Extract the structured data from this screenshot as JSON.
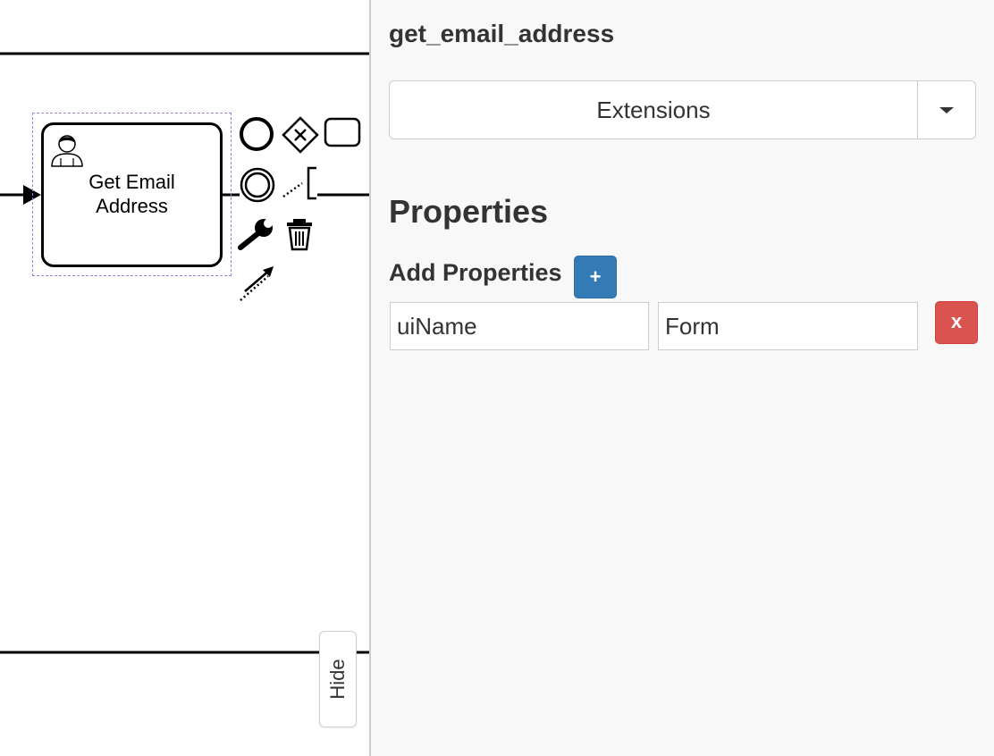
{
  "canvas": {
    "task": {
      "label": "Get Email\nAddress",
      "type_icon": "user-task-icon"
    },
    "context_pad": [
      {
        "name": "start-event-icon"
      },
      {
        "name": "exclusive-gateway-icon"
      },
      {
        "name": "task-icon"
      },
      {
        "name": "intermediate-event-icon"
      },
      {
        "name": "text-annotation-icon"
      },
      {
        "name": "wrench-icon"
      },
      {
        "name": "trash-icon"
      },
      {
        "name": "connect-icon"
      }
    ],
    "hide_label": "Hide"
  },
  "panel": {
    "title": "get_email_address",
    "tab": {
      "selected": "Extensions"
    },
    "section_title": "Properties",
    "add_label": "Add Properties",
    "add_button": "+",
    "properties": [
      {
        "key": "uiName",
        "value": "Form",
        "remove_label": "x"
      }
    ]
  },
  "colors": {
    "add_button": "#337ab7",
    "remove_button": "#d9534f",
    "selection_outline": "#8c84e0",
    "panel_background": "#f8f8f8"
  }
}
